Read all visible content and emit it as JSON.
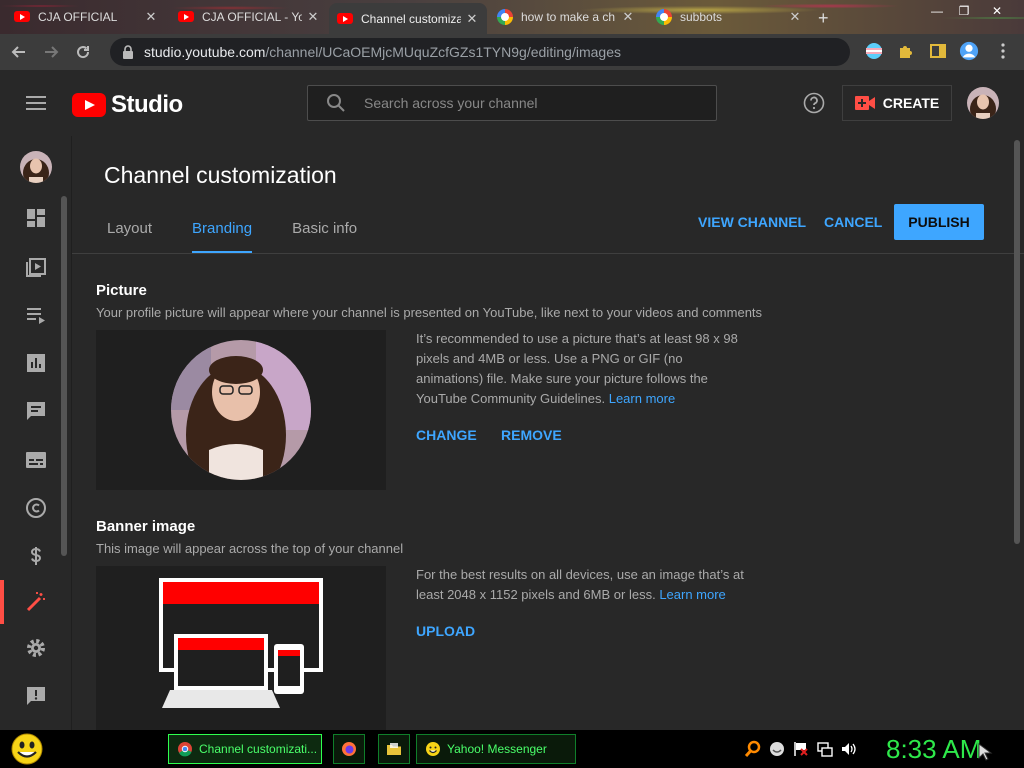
{
  "browser": {
    "tabs": [
      {
        "title": "CJA OFFICIAL",
        "favicon": "youtube-favicon"
      },
      {
        "title": "CJA OFFICIAL - YouTube",
        "favicon": "youtube-favicon"
      },
      {
        "title": "Channel customization",
        "favicon": "youtube-favicon"
      },
      {
        "title": "how to make a ch",
        "favicon": "google-favicon"
      },
      {
        "title": "subbots",
        "favicon": "google-favicon"
      }
    ],
    "url_host": "studio.youtube.com",
    "url_path": "/channel/UCaOEMjcMUquZcfGZs1TYN9g/editing/images"
  },
  "header": {
    "logo_text": "Studio",
    "search_placeholder": "Search across your channel",
    "create_label": "CREATE"
  },
  "page": {
    "title": "Channel customization",
    "tabs": [
      {
        "label": "Layout"
      },
      {
        "label": "Branding"
      },
      {
        "label": "Basic info"
      }
    ],
    "active_tab": "Branding",
    "view_channel_label": "VIEW CHANNEL",
    "cancel_label": "CANCEL",
    "publish_label": "PUBLISH"
  },
  "picture": {
    "title": "Picture",
    "description": "Your profile picture will appear where your channel is presented on YouTube, like next to your videos and comments",
    "info_lines": [
      "It’s recommended to use a picture that’s at least 98 x 98",
      "pixels and 4MB or less. Use a PNG or GIF (no",
      "animations) file. Make sure your picture follows the",
      "YouTube Community Guidelines."
    ],
    "learn_more": "Learn more",
    "change_label": "CHANGE",
    "remove_label": "REMOVE"
  },
  "banner": {
    "title": "Banner image",
    "description": "This image will appear across the top of your channel",
    "info_lines": [
      "For the best results on all devices, use an image that’s at",
      "least 2048 x 1152 pixels and 6MB or less."
    ],
    "learn_more": "Learn more",
    "upload_label": "UPLOAD"
  },
  "taskbar": {
    "items": [
      {
        "label": "Channel customizati...",
        "icon": "chrome-icon"
      },
      {
        "label": "",
        "icon": "firefox-icon"
      },
      {
        "label": "",
        "icon": "folder-icon"
      },
      {
        "label": "Yahoo! Messenger",
        "icon": "yahoo-messenger-icon"
      }
    ],
    "clock": "8:33 AM"
  },
  "colors": {
    "accent": "#3ea6ff",
    "brand_red": "#ff0000",
    "background": "#282828",
    "taskbar_green": "#2ee84a"
  }
}
